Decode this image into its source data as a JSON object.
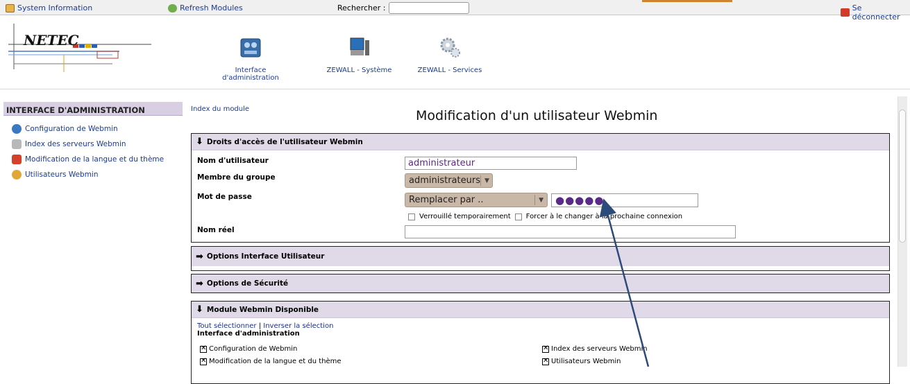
{
  "topbar": {
    "system_info": "System Information",
    "refresh": "Refresh Modules",
    "search_label": "Rechercher :",
    "search_value": "",
    "logout": "Se déconnecter"
  },
  "logo": {
    "text": "NETEC"
  },
  "modules": [
    {
      "label": "Interface d'administration",
      "icon": "admin-icon"
    },
    {
      "label": "ZEWALL - Système",
      "icon": "computer-icon"
    },
    {
      "label": "ZEWALL - Services",
      "icon": "gears-icon"
    }
  ],
  "sidebar": {
    "title": "INTERFACE D'ADMINISTRATION",
    "items": [
      {
        "label": "Configuration de Webmin",
        "icon": "webmin-config-icon"
      },
      {
        "label": "Index des serveurs Webmin",
        "icon": "server-index-icon"
      },
      {
        "label": "Modification de la langue et du thème",
        "icon": "language-theme-icon"
      },
      {
        "label": "Utilisateurs Webmin",
        "icon": "users-icon"
      }
    ]
  },
  "main": {
    "index_link": "Index du module",
    "title": "Modification d'un utilisateur Webmin",
    "access_section": {
      "title": "Droits d'accès de l'utilisateur Webmin",
      "username_label": "Nom d'utilisateur",
      "username_value": "administrateur",
      "group_label": "Membre du groupe",
      "group_value": "administrateurs",
      "password_label": "Mot de passe",
      "password_mode": "Remplacer par ..",
      "password_value": "●●●●●",
      "lock_label": "Verrouillé temporairement",
      "force_change_label": "Forcer à le changer à la prochaine connexion",
      "realname_label": "Nom réel",
      "realname_value": ""
    },
    "ui_options_title": "Options Interface Utilisateur",
    "security_options_title": "Options de Sécurité",
    "modules_section": {
      "title": "Module Webmin Disponible",
      "select_all": "Tout sélectionner",
      "separator": "|",
      "invert": "Inverser la sélection",
      "category": "Interface d'administration",
      "items": [
        {
          "label": "Configuration de Webmin",
          "checked": true
        },
        {
          "label": "Index des serveurs Webmin",
          "checked": true
        },
        {
          "label": "Modification de la langue et du thème",
          "checked": true
        },
        {
          "label": "Utilisateurs Webmin",
          "checked": true
        }
      ]
    }
  }
}
